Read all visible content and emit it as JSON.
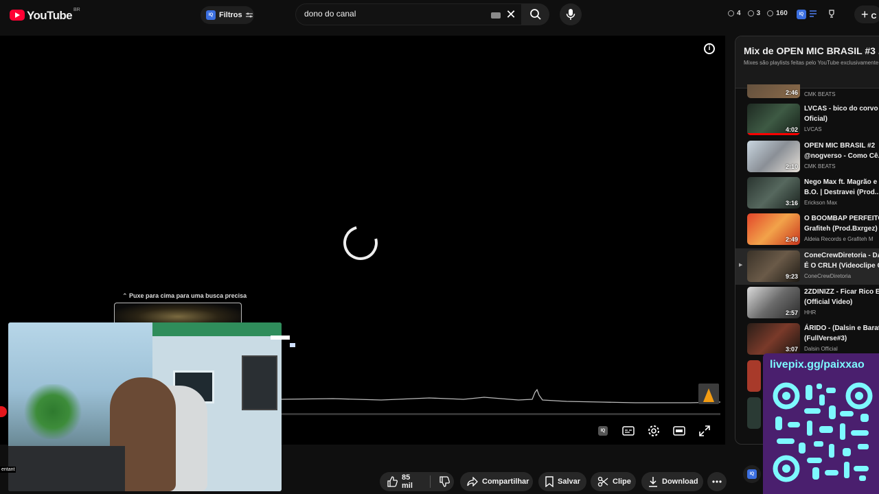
{
  "header": {
    "logo_text": "YouTube",
    "country_code": "BR",
    "filters_label": "Filtros",
    "search_value": "dono do canal",
    "stats": [
      {
        "icon": "clock-icon",
        "value": "4"
      },
      {
        "icon": "eye-icon",
        "value": "3"
      },
      {
        "icon": "views-icon",
        "value": "160"
      }
    ],
    "create_label": "C"
  },
  "player": {
    "state": "loading",
    "search_hint": "Puxe para cima para uma busca precisa",
    "webcam_caption": "entant"
  },
  "actions": {
    "likes": "85 mil",
    "share": "Compartilhar",
    "save": "Salvar",
    "clip": "Clipe",
    "download": "Download"
  },
  "playlist": {
    "title": "Mix de OPEN MIC BRASIL #3 ...",
    "subtitle": "Mixes são playlists feitas pelo YouTube exclusivamente",
    "items": [
      {
        "title1": "",
        "title2": "",
        "channel": "CMK BEATS",
        "duration": "2:46",
        "active": false
      },
      {
        "title1": "LVCAS - bico do corvo (",
        "title2": "Oficial)",
        "channel": "LVCAS",
        "duration": "4:02",
        "active": false
      },
      {
        "title1": "OPEN MIC BRASIL #2",
        "title2": "@nogverso - Como Cê...",
        "channel": "CMK BEATS",
        "duration": "2:10",
        "active": false
      },
      {
        "title1": "Nego Max ft. Magrão e",
        "title2": "B.O. | Destravei (Prod...",
        "channel": "Erickson Max",
        "duration": "3:16",
        "active": false
      },
      {
        "title1": "O BOOMBAP PERFEITO",
        "title2": "Grafiteh (Prod.Bxrgez)",
        "channel": "Aldeia Records e Grafiteh M",
        "duration": "2:49",
        "active": false
      },
      {
        "title1": "ConeCrewDiretoria - DA",
        "title2": "É O CRLH (Videoclipe C",
        "channel": "ConeCrewDiretoria",
        "duration": "9:23",
        "active": true
      },
      {
        "title1": "2ZDINIZZ - Ficar Rico E",
        "title2": "(Official Video)",
        "channel": "HHR",
        "duration": "2:57",
        "active": false
      },
      {
        "title1": "ÁRIDO - (Dalsin e Barat",
        "title2": "(FullVerse#3)",
        "channel": "Dalsin Official",
        "duration": "3:07",
        "active": false
      }
    ]
  },
  "overlay": {
    "livepix_url": "livepix.gg/paixxao"
  },
  "colors": {
    "brand_red": "#ff0033",
    "accent_blue": "#3b6fe0",
    "qr_bg": "#4a1f6e",
    "qr_fg": "#7df9ff"
  }
}
